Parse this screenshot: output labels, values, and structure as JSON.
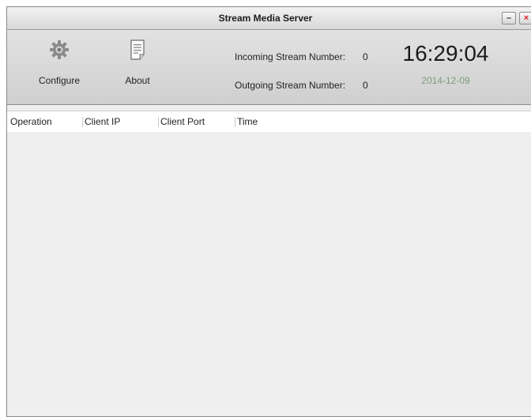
{
  "window": {
    "title": "Stream Media Server",
    "minimize_label": "–",
    "close_label": "×"
  },
  "toolbar": {
    "configure_label": "Configure",
    "about_label": "About",
    "configure_icon": "gear-icon",
    "about_icon": "document-icon"
  },
  "stats": {
    "incoming_label": "Incoming Stream Number:",
    "incoming_value": "0",
    "outgoing_label": "Outgoing Stream Number:",
    "outgoing_value": "0"
  },
  "clock": {
    "time": "16:29:04",
    "date": "2014-12-09",
    "date_color": "#7a9e7a"
  },
  "table": {
    "columns": [
      "Operation",
      "Client IP",
      "Client Port",
      "Time"
    ],
    "rows": []
  }
}
